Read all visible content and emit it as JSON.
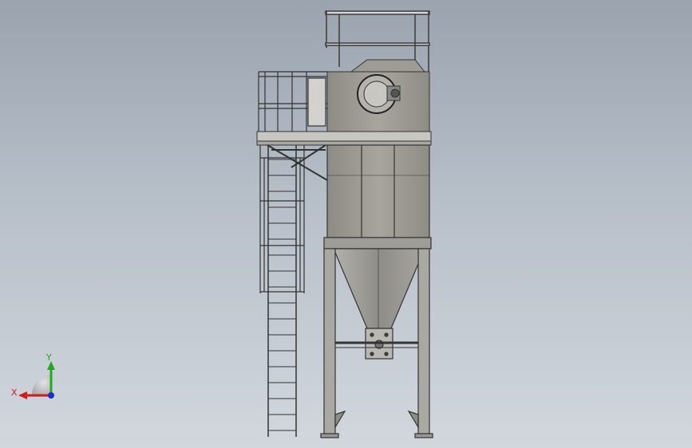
{
  "viewport": {
    "background_top": "#9aa3ae",
    "background_bottom": "#d2d7dd",
    "model": "dust-collector-tower"
  },
  "triad": {
    "x_label": "X",
    "y_label": "Y",
    "x_color": "#d11a1a",
    "y_color": "#1faa1f",
    "z_color": "#1a2fd1"
  }
}
